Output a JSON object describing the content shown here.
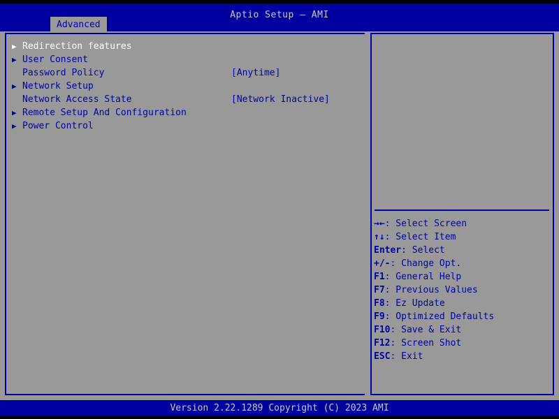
{
  "header": {
    "title": "Aptio Setup – AMI",
    "tabs": [
      {
        "label": "Advanced",
        "active": true
      }
    ]
  },
  "menu": {
    "items": [
      {
        "arrow": "▶",
        "label": "Redirection features",
        "value": "",
        "selected": true
      },
      {
        "arrow": "▶",
        "label": "User Consent",
        "value": "",
        "selected": false
      },
      {
        "arrow": "",
        "label": "Password Policy",
        "value": "[Anytime]",
        "selected": false
      },
      {
        "arrow": "▶",
        "label": "Network Setup",
        "value": "",
        "selected": false
      },
      {
        "arrow": "",
        "label": "Network Access State",
        "value": "[Network Inactive]",
        "selected": false
      },
      {
        "arrow": "▶",
        "label": "Remote Setup And Configuration",
        "value": "",
        "selected": false
      },
      {
        "arrow": "▶",
        "label": "Power Control",
        "value": "",
        "selected": false
      }
    ]
  },
  "help": {
    "rows": [
      {
        "key": "→←",
        "text": ": Select Screen"
      },
      {
        "key": "↑↓",
        "text": ": Select Item"
      },
      {
        "key": "Enter",
        "text": ": Select"
      },
      {
        "key": "+/-",
        "text": ": Change Opt."
      },
      {
        "key": "F1",
        "text": ": General Help"
      },
      {
        "key": "F7",
        "text": ": Previous Values"
      },
      {
        "key": "F8",
        "text": ": Ez Update"
      },
      {
        "key": "F9",
        "text": ": Optimized Defaults"
      },
      {
        "key": "F10",
        "text": ": Save & Exit"
      },
      {
        "key": "F12",
        "text": ": Screen Shot"
      },
      {
        "key": "ESC",
        "text": ": Exit"
      }
    ]
  },
  "footer": {
    "text": "Version 2.22.1289 Copyright (C) 2023 AMI"
  },
  "colors": {
    "bios_blue": "#0000a0",
    "panel_gray": "#999999",
    "selected_white": "#ffffff",
    "footer_text": "#c8c8c8",
    "black": "#000000"
  }
}
